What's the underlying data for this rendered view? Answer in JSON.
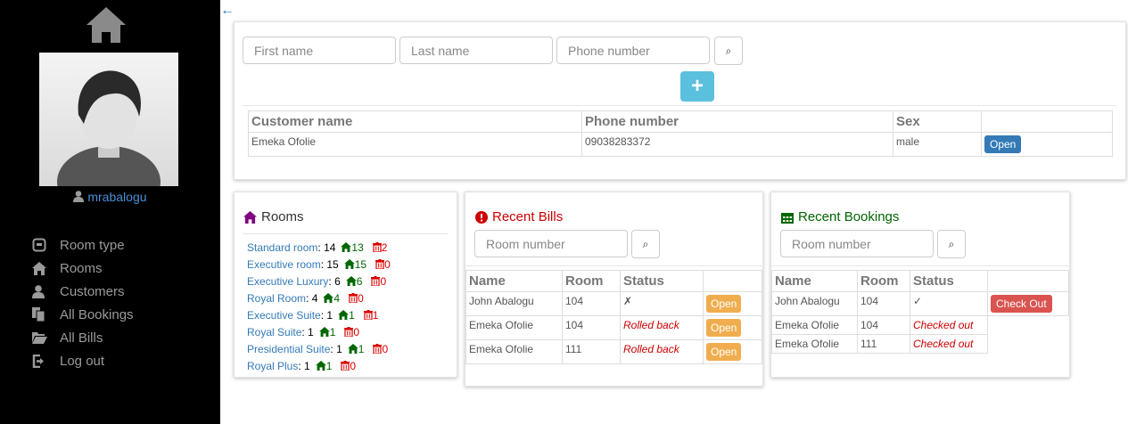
{
  "sidebar": {
    "username": "mrabalogu",
    "nav": [
      {
        "icon": "room-type-icon",
        "label": "Room type"
      },
      {
        "icon": "home-icon",
        "label": "Rooms"
      },
      {
        "icon": "user-icon",
        "label": "Customers"
      },
      {
        "icon": "files-icon",
        "label": "All Bookings"
      },
      {
        "icon": "folder-open-icon",
        "label": "All Bills"
      },
      {
        "icon": "log-out-icon",
        "label": "Log out"
      }
    ]
  },
  "back_arrow": "←",
  "customers": {
    "first_name_placeholder": "First name",
    "last_name_placeholder": "Last name",
    "phone_placeholder": "Phone number",
    "search_symbol": "⌕",
    "add_symbol": "+",
    "headers": [
      "Customer name",
      "Phone number",
      "Sex",
      ""
    ],
    "rows": [
      {
        "name": "Emeka Ofolie",
        "phone": "09038283372",
        "sex": "male",
        "action": "Open"
      }
    ]
  },
  "rooms": {
    "title": "Rooms",
    "items": [
      {
        "name": "Standard room",
        "total": "14",
        "free": "13",
        "deleted": "2"
      },
      {
        "name": "Executive room",
        "total": "15",
        "free": "15",
        "deleted": "0"
      },
      {
        "name": "Executive Luxury",
        "total": "6",
        "free": "6",
        "deleted": "0"
      },
      {
        "name": "Royal Room",
        "total": "4",
        "free": "4",
        "deleted": "0"
      },
      {
        "name": "Executive Suite",
        "total": "1",
        "free": "1",
        "deleted": "1"
      },
      {
        "name": "Royal Suite",
        "total": "1",
        "free": "1",
        "deleted": "0"
      },
      {
        "name": "Presidential Suite",
        "total": "1",
        "free": "1",
        "deleted": "0"
      },
      {
        "name": "Royal Plus",
        "total": "1",
        "free": "1",
        "deleted": "0"
      }
    ]
  },
  "bills": {
    "title": "Recent Bills",
    "search_placeholder": "Room number",
    "headers": [
      "Name",
      "Room",
      "Status",
      ""
    ],
    "rows": [
      {
        "name": "John Abalogu",
        "room": "104",
        "status": "✗",
        "action": "Open"
      },
      {
        "name": "Emeka Ofolie",
        "room": "104",
        "status": "Rolled back",
        "action": "Open"
      },
      {
        "name": "Emeka Ofolie",
        "room": "111",
        "status": "Rolled back",
        "action": "Open"
      }
    ]
  },
  "bookings": {
    "title": "Recent Bookings",
    "search_placeholder": "Room number",
    "headers": [
      "Name",
      "Room",
      "Status",
      ""
    ],
    "rows": [
      {
        "name": "John Abalogu",
        "room": "104",
        "status": "✓",
        "action": "Check Out"
      },
      {
        "name": "Emeka Ofolie",
        "room": "104",
        "status": "Checked out",
        "action": ""
      },
      {
        "name": "Emeka Ofolie",
        "room": "111",
        "status": "Checked out",
        "action": ""
      }
    ]
  },
  "colors": {
    "sidebar_bg": "#000000",
    "accent": "#337ab7",
    "rooms_title": "#800080",
    "bills_title": "#cc0000",
    "bookings_title": "#006600"
  }
}
